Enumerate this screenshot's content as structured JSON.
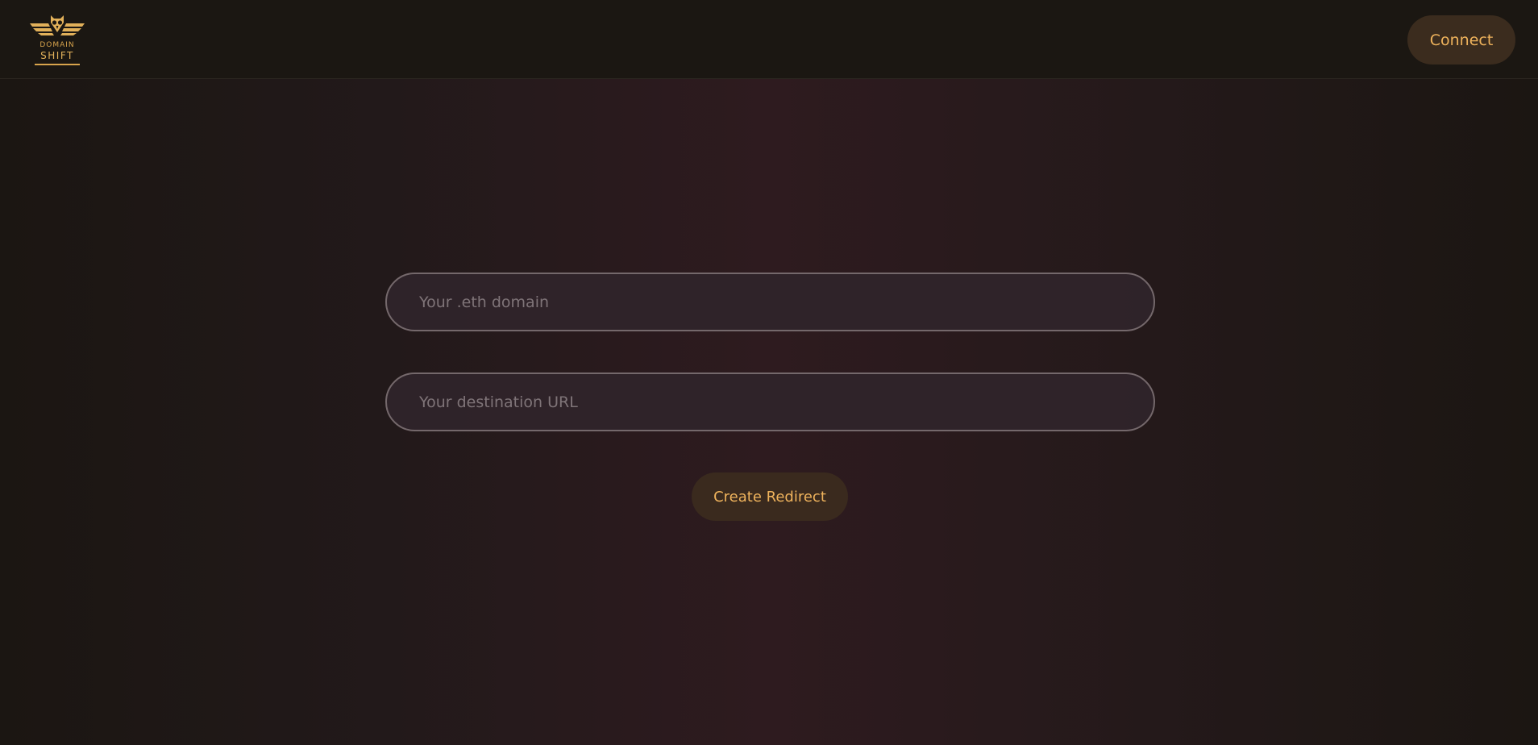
{
  "brand": {
    "logo_icon": "owl-wings-icon",
    "logo_line1": "DOMAIN",
    "logo_line2": "SHIFT",
    "accent_color": "#e2b15a"
  },
  "header": {
    "connect_label": "Connect"
  },
  "form": {
    "domain_placeholder": "Your .eth domain",
    "domain_value": "",
    "url_placeholder": "Your destination URL",
    "url_value": "",
    "submit_label": "Create Redirect"
  },
  "colors": {
    "button_bg": "#3b2c1e",
    "button_text": "#efb35c",
    "field_border": "#74686b",
    "background_center": "#2e1b1f",
    "background_edge": "#1b1612"
  }
}
